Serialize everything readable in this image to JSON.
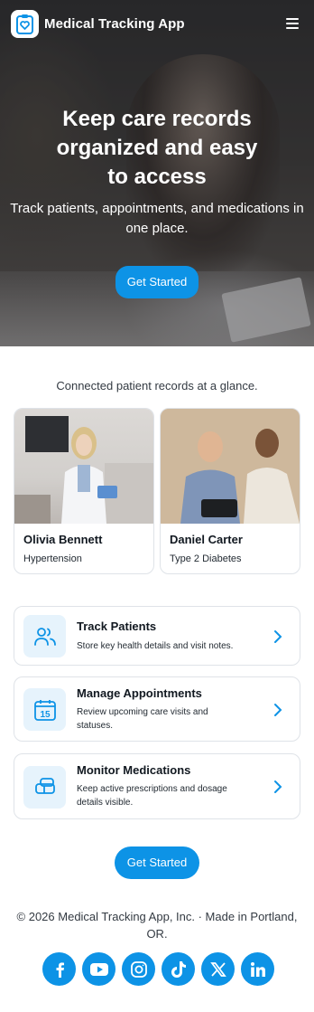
{
  "app": {
    "brand": "Medical Tracking App",
    "accent": "#0d93e6"
  },
  "nav": {
    "logo_icon": "clipboard-heart-icon",
    "menu_icon": "hamburger-menu-icon"
  },
  "hero": {
    "title": "Keep care records organized and easy to access",
    "subtitle": "Track patients, appointments, and medications in one place.",
    "cta_label": "Get Started"
  },
  "records": {
    "caption": "Connected patient records at a glance.",
    "patients": [
      {
        "name": "Olivia Bennett",
        "condition": "Hypertension"
      },
      {
        "name": "Daniel Carter",
        "condition": "Type 2 Diabetes"
      }
    ]
  },
  "features": [
    {
      "title": "Track Patients",
      "description": "Store key health details and visit notes.",
      "icon": "users-icon"
    },
    {
      "title": "Manage Appointments",
      "description": "Review upcoming care visits and statuses.",
      "icon": "calendar-icon",
      "icon_text": "15"
    },
    {
      "title": "Monitor Medications",
      "description": "Keep active prescriptions and dosage details visible.",
      "icon": "pill-icon"
    }
  ],
  "cta": {
    "label": "Get Started"
  },
  "footer": {
    "text": "© 2026 Medical Tracking App, Inc. · Made in Portland, OR.",
    "socials": [
      "facebook-icon",
      "youtube-icon",
      "instagram-icon",
      "tiktok-icon",
      "x-icon",
      "linkedin-icon"
    ]
  }
}
